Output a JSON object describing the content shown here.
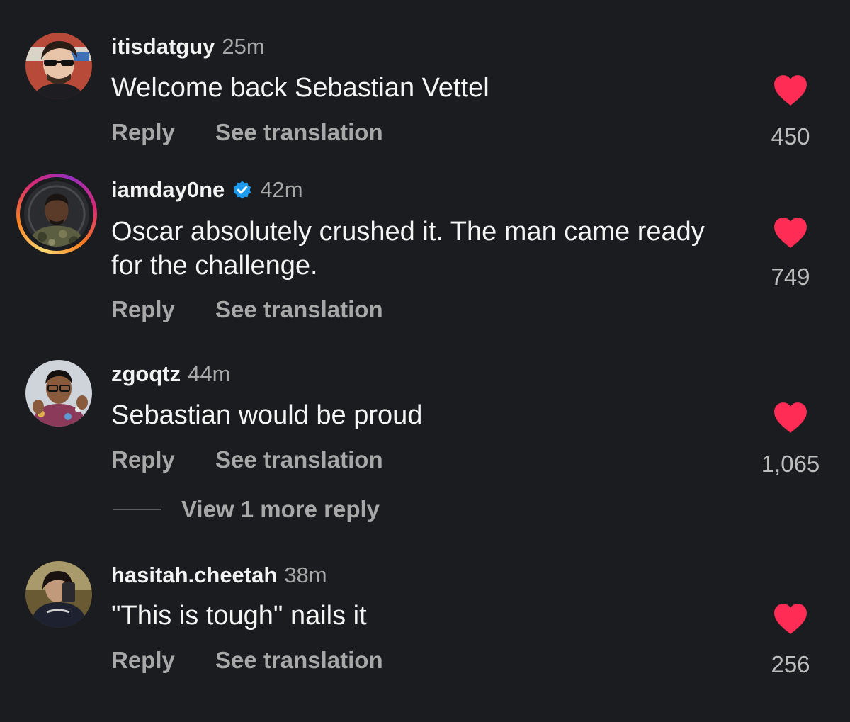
{
  "actions": {
    "reply": "Reply",
    "translate": "See translation"
  },
  "colors": {
    "background": "#1a1c1f",
    "heart": "#ff2d55",
    "muted": "#a8a8a8",
    "verified": "#1d9bf0"
  },
  "comments": [
    {
      "username": "itisdatguy",
      "time": "25m",
      "text": "Welcome back Sebastian Vettel",
      "likes": "450",
      "verified": false
    },
    {
      "username": "iamday0ne",
      "time": "42m",
      "text": "Oscar absolutely crushed it. The man came ready for the challenge.",
      "likes": "749",
      "verified": true,
      "story_ring": true
    },
    {
      "username": "zgoqtz",
      "time": "44m",
      "text": "Sebastian would be proud",
      "likes": "1,065",
      "verified": false
    },
    {
      "username": "hasitah.cheetah",
      "time": "38m",
      "text": "\"This is tough\" nails it",
      "likes": "256",
      "verified": false
    }
  ],
  "view_more": "View 1 more reply"
}
